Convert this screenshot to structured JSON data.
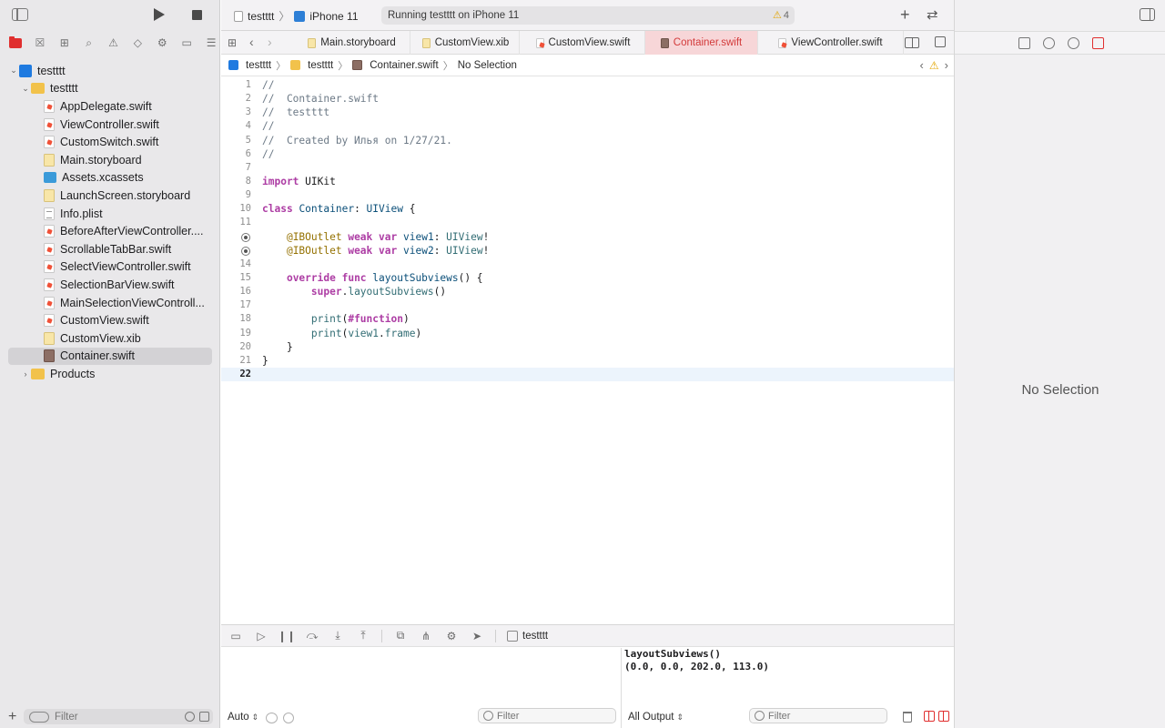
{
  "toolbar": {
    "scheme": "testttt",
    "device": "iPhone 11",
    "status": "Running testttt on iPhone 11",
    "warning_count": "4"
  },
  "navigator": {
    "project": "testttt",
    "group": "testttt",
    "files": [
      {
        "name": "AppDelegate.swift",
        "kind": "swift"
      },
      {
        "name": "ViewController.swift",
        "kind": "swift"
      },
      {
        "name": "CustomSwitch.swift",
        "kind": "swift"
      },
      {
        "name": "Main.storyboard",
        "kind": "storyboard"
      },
      {
        "name": "Assets.xcassets",
        "kind": "assets"
      },
      {
        "name": "LaunchScreen.storyboard",
        "kind": "storyboard"
      },
      {
        "name": "Info.plist",
        "kind": "plist"
      },
      {
        "name": "BeforeAfterViewController....",
        "kind": "swift"
      },
      {
        "name": "ScrollableTabBar.swift",
        "kind": "swift"
      },
      {
        "name": "SelectViewController.swift",
        "kind": "swift"
      },
      {
        "name": "SelectionBarView.swift",
        "kind": "swift"
      },
      {
        "name": "MainSelectionViewControll...",
        "kind": "swift"
      },
      {
        "name": "CustomView.swift",
        "kind": "swift"
      },
      {
        "name": "CustomView.xib",
        "kind": "xib"
      },
      {
        "name": "Container.swift",
        "kind": "container-swift",
        "selected": true
      }
    ],
    "products": "Products",
    "filter_placeholder": "Filter"
  },
  "tabs": [
    {
      "label": "Main.storyboard",
      "kind": "storyboard"
    },
    {
      "label": "CustomView.xib",
      "kind": "xib"
    },
    {
      "label": "CustomView.swift",
      "kind": "swift"
    },
    {
      "label": "Container.swift",
      "kind": "container-swift",
      "active": true
    },
    {
      "label": "ViewController.swift",
      "kind": "swift"
    }
  ],
  "jumpbar": {
    "project": "testttt",
    "group": "testttt",
    "file": "Container.swift",
    "selection": "No Selection"
  },
  "code": {
    "current_line": 22,
    "lines": [
      [
        [
          "comment",
          "//"
        ]
      ],
      [
        [
          "comment",
          "//  Container.swift"
        ]
      ],
      [
        [
          "comment",
          "//  testttt"
        ]
      ],
      [
        [
          "comment",
          "//"
        ]
      ],
      [
        [
          "comment",
          "//  Created by Илья on 1/27/21."
        ]
      ],
      [
        [
          "comment",
          "//"
        ]
      ],
      [],
      [
        [
          "kw",
          "import"
        ],
        [
          "plain",
          " UIKit"
        ]
      ],
      [],
      [
        [
          "kw",
          "class"
        ],
        [
          "plain",
          " "
        ],
        [
          "type",
          "Container"
        ],
        [
          "plain",
          ": "
        ],
        [
          "type",
          "UIView"
        ],
        [
          "plain",
          " {"
        ]
      ],
      [],
      [
        [
          "plain",
          "    "
        ],
        [
          "attr",
          "@IBOutlet"
        ],
        [
          "plain",
          " "
        ],
        [
          "kw",
          "weak"
        ],
        [
          "plain",
          " "
        ],
        [
          "kw",
          "var"
        ],
        [
          "plain",
          " "
        ],
        [
          "type",
          "view1"
        ],
        [
          "plain",
          ": "
        ],
        [
          "ident",
          "UIView"
        ],
        [
          "plain",
          "!"
        ]
      ],
      [
        [
          "plain",
          "    "
        ],
        [
          "attr",
          "@IBOutlet"
        ],
        [
          "plain",
          " "
        ],
        [
          "kw",
          "weak"
        ],
        [
          "plain",
          " "
        ],
        [
          "kw",
          "var"
        ],
        [
          "plain",
          " "
        ],
        [
          "type",
          "view2"
        ],
        [
          "plain",
          ": "
        ],
        [
          "ident",
          "UIView"
        ],
        [
          "plain",
          "!"
        ]
      ],
      [],
      [
        [
          "plain",
          "    "
        ],
        [
          "kw",
          "override"
        ],
        [
          "plain",
          " "
        ],
        [
          "kw",
          "func"
        ],
        [
          "plain",
          " "
        ],
        [
          "type",
          "layoutSubviews"
        ],
        [
          "plain",
          "() {"
        ]
      ],
      [
        [
          "plain",
          "        "
        ],
        [
          "kw",
          "super"
        ],
        [
          "plain",
          "."
        ],
        [
          "ident",
          "layoutSubviews"
        ],
        [
          "plain",
          "()"
        ]
      ],
      [],
      [
        [
          "plain",
          "        "
        ],
        [
          "ident",
          "print"
        ],
        [
          "plain",
          "("
        ],
        [
          "kw",
          "#function"
        ],
        [
          "plain",
          ")"
        ]
      ],
      [
        [
          "plain",
          "        "
        ],
        [
          "ident",
          "print"
        ],
        [
          "plain",
          "("
        ],
        [
          "ident",
          "view1"
        ],
        [
          "plain",
          "."
        ],
        [
          "ident",
          "frame"
        ],
        [
          "plain",
          ")"
        ]
      ],
      [
        [
          "plain",
          "    }"
        ]
      ],
      [
        [
          "plain",
          "}"
        ]
      ],
      []
    ],
    "outlet_lines": [
      12,
      13
    ]
  },
  "debug": {
    "target": "testttt",
    "console_output": "layoutSubviews()\n(0.0, 0.0, 202.0, 113.0)",
    "variables_scope": "Auto",
    "console_scope": "All Output",
    "filter_placeholder": "Filter"
  },
  "inspector": {
    "empty_message": "No Selection"
  },
  "colors": {
    "accent": "#e02f2f",
    "keyword": "#ad3da4",
    "comment": "#6c7986",
    "type": "#0b4f79",
    "warning": "#e3a500"
  }
}
